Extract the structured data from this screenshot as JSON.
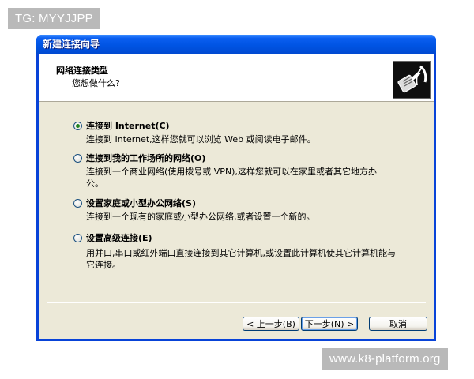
{
  "watermarks": {
    "top": "TG: MYYJJPP",
    "bottom": "www.k8-platform.org"
  },
  "window": {
    "title": "新建连接向导"
  },
  "header": {
    "title": "网络连接类型",
    "subtitle": "您想做什么?",
    "icon": "network-cable-icon"
  },
  "options": [
    {
      "label": "连接到 Internet(C)",
      "description": "连接到 Internet,这样您就可以浏览 Web 或阅读电子邮件。",
      "checked": true
    },
    {
      "label": "连接到我的工作场所的网络(O)",
      "description": "连接到一个商业网络(使用拨号或 VPN),这样您就可以在家里或者其它地方办公。",
      "checked": false
    },
    {
      "label": "设置家庭或小型办公网络(S)",
      "description": "连接到一个现有的家庭或小型办公网络,或者设置一个新的。",
      "checked": false
    },
    {
      "label": "设置高级连接(E)",
      "description": "用并口,串口或红外端口直接连接到其它计算机,或设置此计算机使其它计算机能与它连接。",
      "checked": false
    }
  ],
  "buttons": {
    "back": "< 上一步(B)",
    "next": "下一步(N) >",
    "cancel": "取消"
  }
}
